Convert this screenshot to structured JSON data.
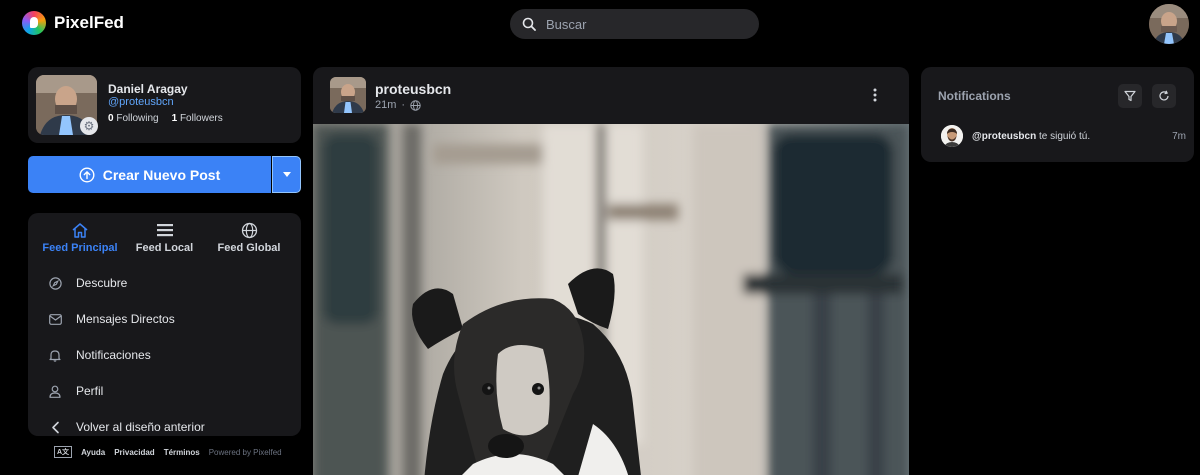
{
  "app": {
    "name": "PixelFed"
  },
  "search": {
    "placeholder": "Buscar"
  },
  "profile": {
    "name": "Daniel Aragay",
    "handle": "@proteusbcn",
    "following_count": "0",
    "following_label": "Following",
    "followers_count": "1",
    "followers_label": "Followers"
  },
  "create_post": {
    "label": "Crear Nuevo Post"
  },
  "feeds": [
    {
      "label": "Feed Principal",
      "icon": "home-icon",
      "active": true
    },
    {
      "label": "Feed Local",
      "icon": "list-icon",
      "active": false
    },
    {
      "label": "Feed Global",
      "icon": "globe-icon",
      "active": false
    }
  ],
  "nav": [
    {
      "label": "Descubre",
      "icon": "compass-icon"
    },
    {
      "label": "Mensajes Directos",
      "icon": "mail-icon"
    },
    {
      "label": "Notificaciones",
      "icon": "bell-icon"
    },
    {
      "label": "Perfil",
      "icon": "user-icon"
    },
    {
      "label": "Volver al diseño anterior",
      "icon": "chevron-left-icon"
    }
  ],
  "footer": {
    "lang_icon": "A文",
    "links": [
      "Ayuda",
      "Privacidad",
      "Términos"
    ],
    "powered": "Powered by Pixelfed"
  },
  "post": {
    "username": "proteusbcn",
    "time": "21m",
    "separator": "·",
    "visibility_icon": "globe-icon"
  },
  "notifications": {
    "title": "Notifications",
    "items": [
      {
        "actor": "@proteusbcn",
        "text": "te siguió tú.",
        "time": "7m"
      }
    ]
  },
  "colors": {
    "accent": "#3b82f6",
    "handle": "#60a5fa",
    "background": "#000000",
    "card": "#18181b"
  }
}
